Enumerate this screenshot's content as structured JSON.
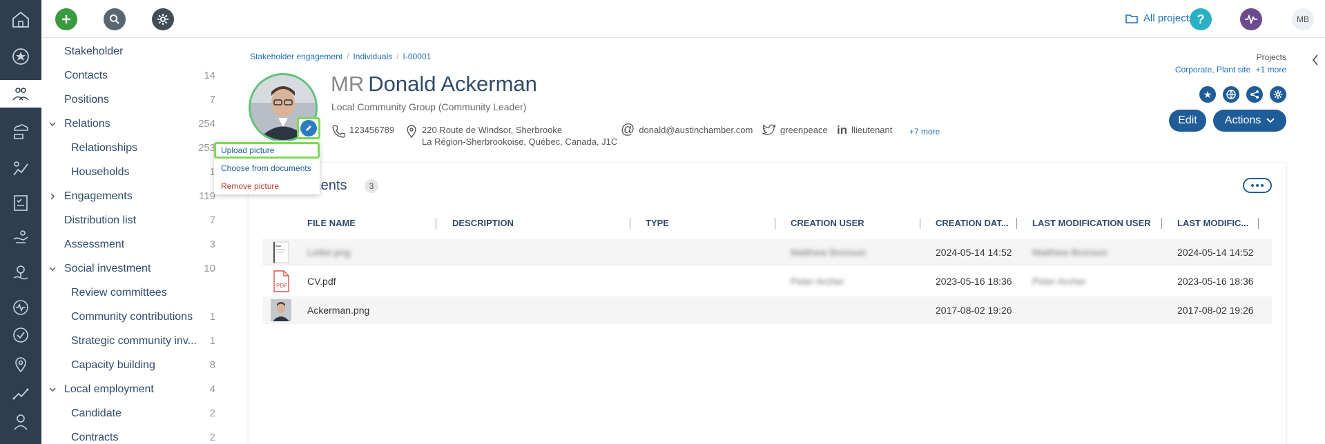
{
  "colors": {
    "rail": "#2e3e50",
    "accent": "#1f5d99",
    "link": "#1f6fb2",
    "highlight": "#7ed957",
    "add": "#3a9a3f",
    "help": "#2ab0c6",
    "activity": "#6c4a8e"
  },
  "rail": {
    "icons": [
      "home-icon",
      "star-icon",
      "stakeholder-icon",
      "cloud-hand-icon",
      "growth-icon",
      "checklist-icon",
      "hand-icon",
      "tree-hand-icon",
      "pulse-icon",
      "check-circle-icon",
      "location-icon",
      "trend-icon",
      "user-icon"
    ],
    "active_index": 2
  },
  "topbar": {
    "all_projects": "All projects",
    "user_initials": "MB"
  },
  "sidenav": {
    "items": [
      {
        "label": "Stakeholder",
        "count": "",
        "indent": 0,
        "chevron": ""
      },
      {
        "label": "Contacts",
        "count": "14",
        "indent": 0,
        "chevron": ""
      },
      {
        "label": "Positions",
        "count": "7",
        "indent": 0,
        "chevron": ""
      },
      {
        "label": "Relations",
        "count": "254",
        "indent": 0,
        "chevron": "down"
      },
      {
        "label": "Relationships",
        "count": "253",
        "indent": 1,
        "chevron": ""
      },
      {
        "label": "Households",
        "count": "1",
        "indent": 1,
        "chevron": ""
      },
      {
        "label": "Engagements",
        "count": "119",
        "indent": 0,
        "chevron": "right"
      },
      {
        "label": "Distribution list",
        "count": "7",
        "indent": 0,
        "chevron": ""
      },
      {
        "label": "Assessment",
        "count": "3",
        "indent": 0,
        "chevron": ""
      },
      {
        "label": "Social investment",
        "count": "10",
        "indent": 0,
        "chevron": "down"
      },
      {
        "label": "Review committees",
        "count": "",
        "indent": 1,
        "chevron": ""
      },
      {
        "label": "Community contributions",
        "count": "1",
        "indent": 1,
        "chevron": ""
      },
      {
        "label": "Strategic community inv...",
        "count": "1",
        "indent": 1,
        "chevron": ""
      },
      {
        "label": "Capacity building",
        "count": "8",
        "indent": 1,
        "chevron": ""
      },
      {
        "label": "Local employment",
        "count": "4",
        "indent": 0,
        "chevron": "down"
      },
      {
        "label": "Candidate",
        "count": "2",
        "indent": 1,
        "chevron": ""
      },
      {
        "label": "Contracts",
        "count": "2",
        "indent": 1,
        "chevron": ""
      }
    ]
  },
  "breadcrumb": [
    "Stakeholder engagement",
    "Individuals",
    "I-00001"
  ],
  "projects": {
    "label": "Projects",
    "value": "Corporate, Plant site",
    "more": "+1 more"
  },
  "profile": {
    "salutation": "MR",
    "name": "Donald Ackerman",
    "organization": "Local Community Group (Community Leader)",
    "phone": "123456789",
    "address_line1": "220 Route de Windsor, Sherbrooke",
    "address_line2": "La Région-Sherbrookoise, Québec, Canada, J1C",
    "email": "donald@austinchamber.com",
    "twitter": "greenpeace",
    "linkedin": "llieutenant",
    "more": "+7 more"
  },
  "buttons": {
    "edit": "Edit",
    "actions": "Actions"
  },
  "photo_menu": {
    "upload": "Upload picture",
    "choose": "Choose from documents",
    "remove": "Remove picture"
  },
  "documents": {
    "title": "Documents",
    "title_visible": "ments",
    "count": "3",
    "columns": [
      "FILE NAME",
      "DESCRIPTION",
      "TYPE",
      "CREATION USER",
      "CREATION DAT...",
      "LAST MODIFICATION USER",
      "LAST MODIFIC..."
    ],
    "rows": [
      {
        "thumb": "doc-thumbnail",
        "file_name": "Letter.png",
        "description": "",
        "type": "",
        "creation_user": "Matthew Bronson",
        "creation_date": "2024-05-14 14:52",
        "last_mod_user": "Matthew Bronson",
        "last_mod_date": "2024-05-14 14:52",
        "blurred": true
      },
      {
        "thumb": "pdf-icon",
        "file_name": "CV.pdf",
        "description": "",
        "type": "",
        "creation_user": "Peter Archer",
        "creation_date": "2023-05-16 18:36",
        "last_mod_user": "Peter Archer",
        "last_mod_date": "2023-05-16 18:36",
        "blurred": false
      },
      {
        "thumb": "photo-thumbnail",
        "file_name": "Ackerman.png",
        "description": "",
        "type": "",
        "creation_user": "",
        "creation_date": "2017-08-02 19:26",
        "last_mod_user": "",
        "last_mod_date": "2017-08-02 19:26",
        "blurred": false
      }
    ]
  }
}
